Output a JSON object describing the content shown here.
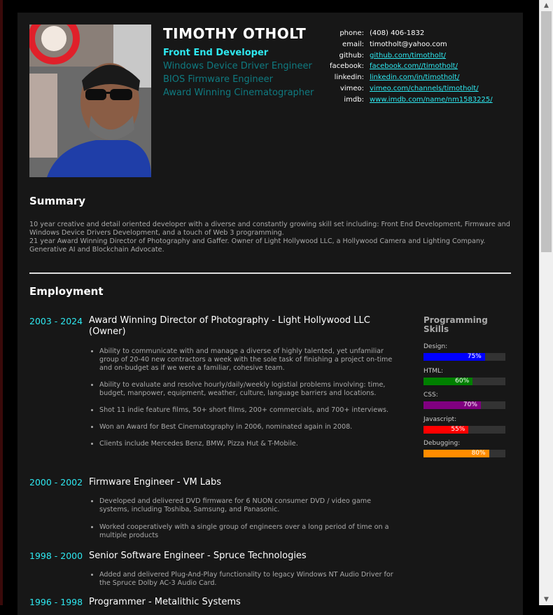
{
  "header": {
    "name": "TIMOTHY OTHOLT",
    "primary_role": "Front End Developer",
    "roles": [
      "Windows Device Driver Engineer",
      "BIOS Firmware Engineer",
      "Award Winning Cinematographer"
    ]
  },
  "contact": [
    {
      "label": "phone:",
      "value": "(408) 406-1832",
      "link": false
    },
    {
      "label": "email:",
      "value": "timotholt@yahoo.com",
      "link": false
    },
    {
      "label": "github:",
      "value": "github.com/timotholt/",
      "link": true
    },
    {
      "label": "facebook:",
      "value": "facebook.com//timotholt/",
      "link": true
    },
    {
      "label": "linkedin:",
      "value": "linkedin.com/in/timotholt/",
      "link": true
    },
    {
      "label": "vimeo:",
      "value": "vimeo.com/channels/timotholt/",
      "link": true
    },
    {
      "label": "imdb:",
      "value": "www.imdb.com/name/nm1583225/",
      "link": true
    }
  ],
  "summary": {
    "heading": "Summary",
    "lines": [
      "10 year creative and detail oriented developer with a diverse and constantly growing skill set including: Front End Development, Firmware and Windows Device Drivers Development, and a touch of Web 3 programming.",
      "21 year Award Winning Director of Photography and Gaffer. Owner of Light Hollywood LLC, a Hollywood Camera and Lighting Company. Generative AI and Blockchain Advocate."
    ]
  },
  "employment": {
    "heading": "Employment",
    "jobs": [
      {
        "years": "2003 - 2024",
        "title": "Award Winning Director of Photography - Light Hollywood LLC (Owner)",
        "duties": [
          "Ability to communicate with and manage a diverse of highly talented, yet unfamiliar group of 20-40 new contractors a week with the sole task of finishing a project on-time and on-budget as if we were a familiar, cohesive team.",
          "Ability to evaluate and resolve hourly/daily/weekly logistial problems involving: time, budget, manpower, equipment, weather, culture, language barriers and locations.",
          "Shot 11 indie feature films, 50+ short films, 200+ commercials, and 700+ interviews.",
          "Won an Award for Best Cinematography in 2006, nominated again in 2008.",
          "Clients include Mercedes Benz, BMW, Pizza Hut & T-Mobile."
        ]
      },
      {
        "years": "2000 - 2002",
        "title": "Firmware Engineer - VM Labs",
        "duties": [
          "Developed and delivered DVD firmware for 6 NUON consumer DVD / video game systems, including Toshiba, Samsung, and Panasonic.",
          "Worked cooperatively with a single group of engineers over a long period of time on a multiple products"
        ]
      },
      {
        "years": "1998 - 2000",
        "title": "Senior Software Engineer - Spruce Technologies",
        "duties": [
          "Added and delivered Plug-And-Play functionality to legacy Windows NT Audio Driver for the Spruce Dolby AC-3 Audio Card."
        ]
      },
      {
        "years": "1996 - 1998",
        "title": "Programmer - Metalithic Systems",
        "duties": []
      }
    ]
  },
  "skills": {
    "title": "Programming Skills",
    "items": [
      {
        "label": "Design:",
        "value": 75,
        "text": "75%",
        "color": "#0000ff"
      },
      {
        "label": "HTML:",
        "value": 60,
        "text": "60%",
        "color": "#008000"
      },
      {
        "label": "CSS:",
        "value": 70,
        "text": "70%",
        "color": "#800080"
      },
      {
        "label": "Javascript:",
        "value": 55,
        "text": "55%",
        "color": "#ff0000"
      },
      {
        "label": "Debugging:",
        "value": 80,
        "text": "80%",
        "color": "#ff8c00"
      }
    ]
  }
}
